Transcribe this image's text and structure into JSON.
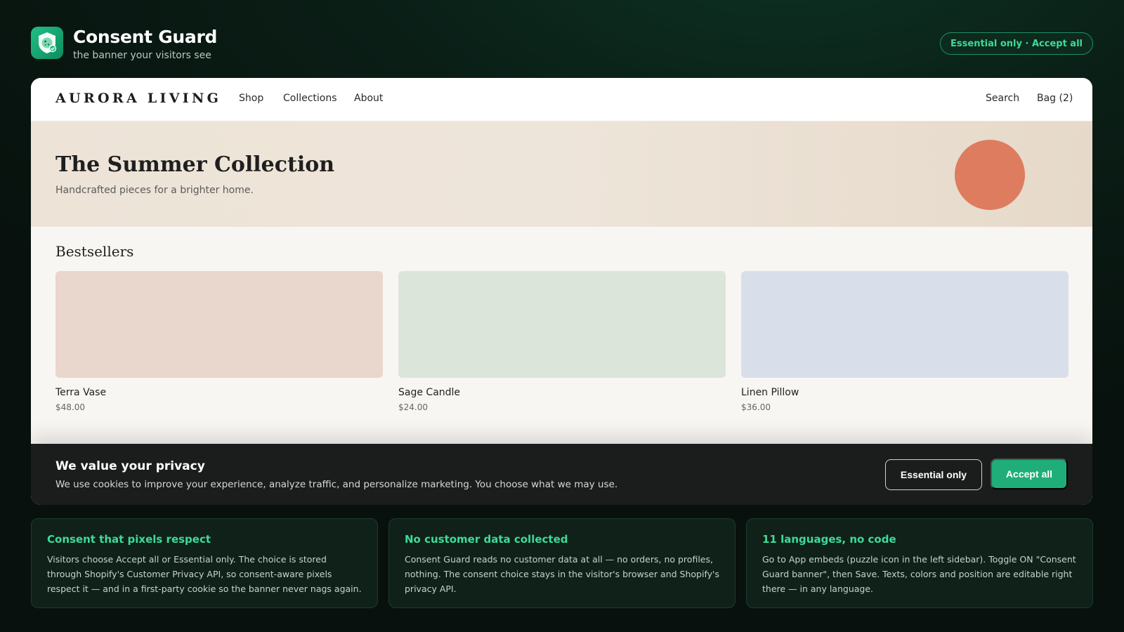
{
  "app": {
    "title": "Consent Guard",
    "subtitle": "the banner your visitors see",
    "mode_pill": "Essential only · Accept all",
    "logo_icon": "shield-cookie-icon",
    "accent_color": "#1fae7a"
  },
  "store": {
    "brand": "AURORA LIVING",
    "nav": {
      "shop": "Shop",
      "collections": "Collections",
      "about": "About",
      "search": "Search",
      "bag": "Bag (2)"
    },
    "hero": {
      "title": "The Summer Collection",
      "subtitle": "Handcrafted pieces for a brighter home."
    },
    "section_title": "Bestsellers",
    "products": [
      {
        "name": "Terra Vase",
        "price": "$48.00",
        "color": "#e9d6cd"
      },
      {
        "name": "Sage Candle",
        "price": "$24.00",
        "color": "#dbe5da"
      },
      {
        "name": "Linen Pillow",
        "price": "$36.00",
        "color": "#d8dfea"
      }
    ]
  },
  "banner": {
    "title": "We value your privacy",
    "text": "We use cookies to improve your experience, analyze traffic, and personalize marketing. You choose what we may use.",
    "essential_label": "Essential only",
    "accept_label": "Accept all"
  },
  "features": [
    {
      "title": "Consent that pixels respect",
      "text": "Visitors choose Accept all or Essential only. The choice is stored through Shopify's Customer Privacy API, so consent-aware pixels respect it — and in a first-party cookie so the banner never nags again."
    },
    {
      "title": "No customer data collected",
      "text": "Consent Guard reads no customer data at all — no orders, no profiles, nothing. The consent choice stays in the visitor's browser and Shopify's privacy API."
    },
    {
      "title": "11 languages, no code",
      "text": "Go to App embeds (puzzle icon in the left sidebar). Toggle ON \"Consent Guard banner\", then Save. Texts, colors and position are editable right there — in any language."
    }
  ]
}
